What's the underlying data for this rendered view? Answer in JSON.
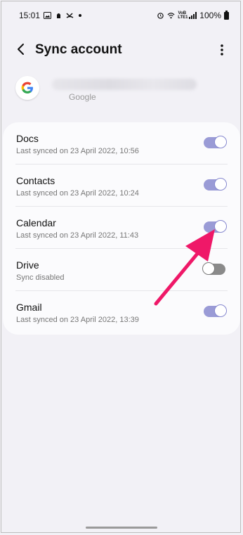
{
  "status_bar": {
    "time": "15:01",
    "volte_label": "VoB LTE1",
    "battery": "100%"
  },
  "header": {
    "title": "Sync account"
  },
  "account": {
    "type": "Google"
  },
  "sync_items": [
    {
      "name": "Docs",
      "status": "Last synced on 23 April 2022, 10:56",
      "enabled": true
    },
    {
      "name": "Contacts",
      "status": "Last synced on 23 April 2022, 10:24",
      "enabled": true
    },
    {
      "name": "Calendar",
      "status": "Last synced on 23 April 2022, 11:43",
      "enabled": true
    },
    {
      "name": "Drive",
      "status": "Sync disabled",
      "enabled": false
    },
    {
      "name": "Gmail",
      "status": "Last synced on 23 April 2022, 13:39",
      "enabled": true
    }
  ],
  "colors": {
    "toggle_on": "#9a9bd6",
    "toggle_off": "#8a8a8a",
    "annotation_arrow": "#ef1868"
  }
}
